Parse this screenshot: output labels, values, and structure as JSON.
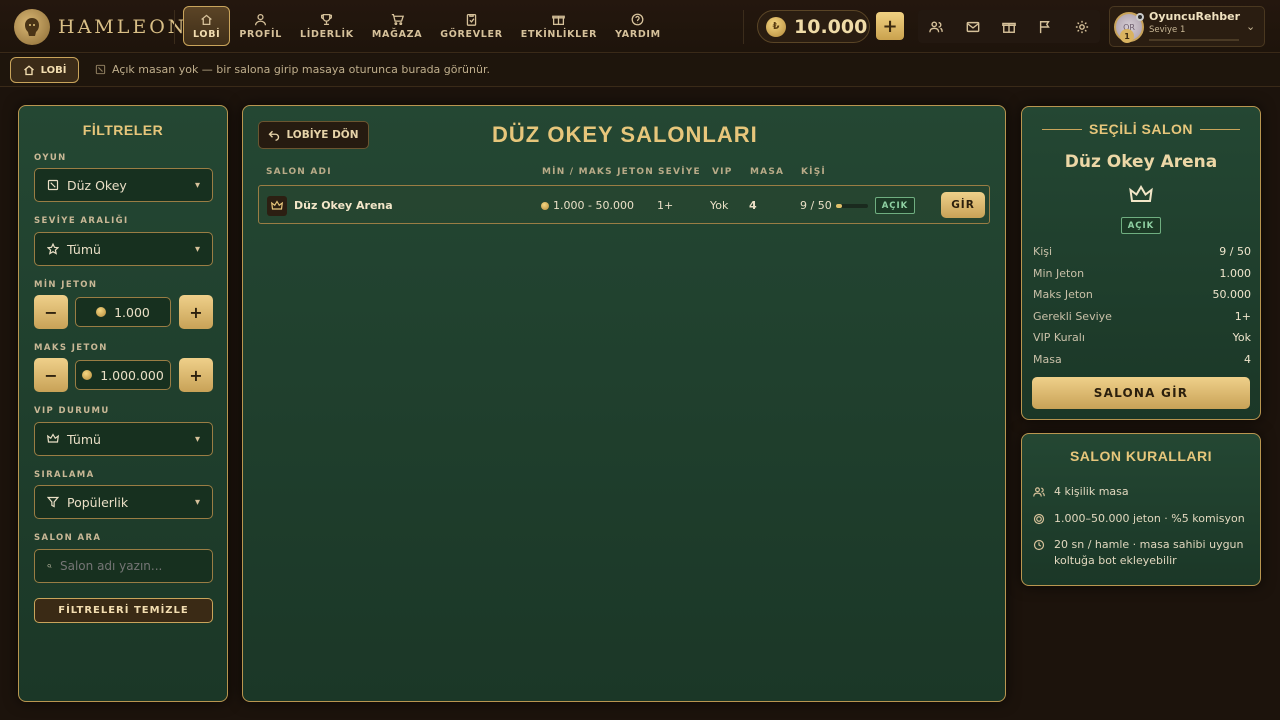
{
  "brand": {
    "name": "HAMLEON"
  },
  "nav": [
    {
      "label": "LOBİ",
      "icon": "home-icon",
      "active": true
    },
    {
      "label": "PROFİL",
      "icon": "user-icon"
    },
    {
      "label": "LİDERLİK",
      "icon": "trophy-icon"
    },
    {
      "label": "MAĞAZA",
      "icon": "cart-icon"
    },
    {
      "label": "GÖREVLER",
      "icon": "clipboard-icon"
    },
    {
      "label": "ETKİNLİKLER",
      "icon": "gift-icon"
    },
    {
      "label": "YARDIM",
      "icon": "help-icon"
    }
  ],
  "wallet": {
    "balance": "10.000",
    "add_label": "+"
  },
  "top_icons": [
    "users-icon",
    "mail-icon",
    "gift-icon",
    "flag-icon",
    "settings-icon"
  ],
  "user": {
    "name": "OyuncuRehber",
    "level": "Seviye 1",
    "avatar_initials": "OR",
    "avatar_level": "1"
  },
  "subbar": {
    "lobby_label": "LOBİ",
    "message": "Açık masan yok — bir salona girip masaya oturunca burada görünür."
  },
  "filters": {
    "title": "FİLTRELER",
    "game": {
      "label": "OYUN",
      "value": "Düz Okey"
    },
    "level_range": {
      "label": "SEVİYE ARALIĞI",
      "value": "Tümü"
    },
    "min_coin": {
      "label": "MİN JETON",
      "value": "1.000",
      "minus": "−",
      "plus": "+"
    },
    "max_coin": {
      "label": "MAKS JETON",
      "value": "1.000.000",
      "minus": "−",
      "plus": "+"
    },
    "vip": {
      "label": "VIP DURUMU",
      "value": "Tümü"
    },
    "sort": {
      "label": "SIRALAMA",
      "value": "Popülerlik"
    },
    "search": {
      "label": "SALON ARA",
      "placeholder": "Salon adı yazın..."
    },
    "clear_label": "FİLTRELERİ TEMİZLE"
  },
  "main": {
    "back_label": "LOBİYE DÖN",
    "title": "DÜZ OKEY SALONLARI",
    "columns": [
      "SALON ADI",
      "MİN / MAKS JETON",
      "SEVİYE",
      "VIP",
      "MASA",
      "KİŞİ"
    ],
    "rows": [
      {
        "name": "Düz Okey Arena",
        "coins": "1.000 - 50.000",
        "level": "1+",
        "vip": "Yok",
        "tables": "4",
        "players": "9 / 50",
        "occupancy": 0.18,
        "status": "AÇIK",
        "enter_label": "GİR"
      }
    ]
  },
  "selected": {
    "header": "SEÇİLİ SALON",
    "name": "Düz Okey Arena",
    "status": "AÇIK",
    "details": [
      {
        "label": "Kişi",
        "value": "9 / 50"
      },
      {
        "label": "Min Jeton",
        "value": "1.000"
      },
      {
        "label": "Maks Jeton",
        "value": "50.000"
      },
      {
        "label": "Gerekli Seviye",
        "value": "1+"
      },
      {
        "label": "VIP Kuralı",
        "value": "Yok"
      },
      {
        "label": "Masa",
        "value": "4"
      }
    ],
    "enter_label": "SALONA GİR"
  },
  "rules": {
    "title": "SALON KURALLARI",
    "items": [
      {
        "icon": "users-icon",
        "text": "4 kişilik masa"
      },
      {
        "icon": "coin-icon",
        "text": "1.000–50.000 jeton · %5 komisyon"
      },
      {
        "icon": "clock-icon",
        "text": "20 sn / hamle · masa sahibi uygun koltuğa bot ekleyebilir"
      }
    ]
  },
  "colors": {
    "gold": "#e7c67b",
    "felt": "#1f3f2c",
    "frame": "#b99650",
    "status_open": "#8fd1a3"
  }
}
